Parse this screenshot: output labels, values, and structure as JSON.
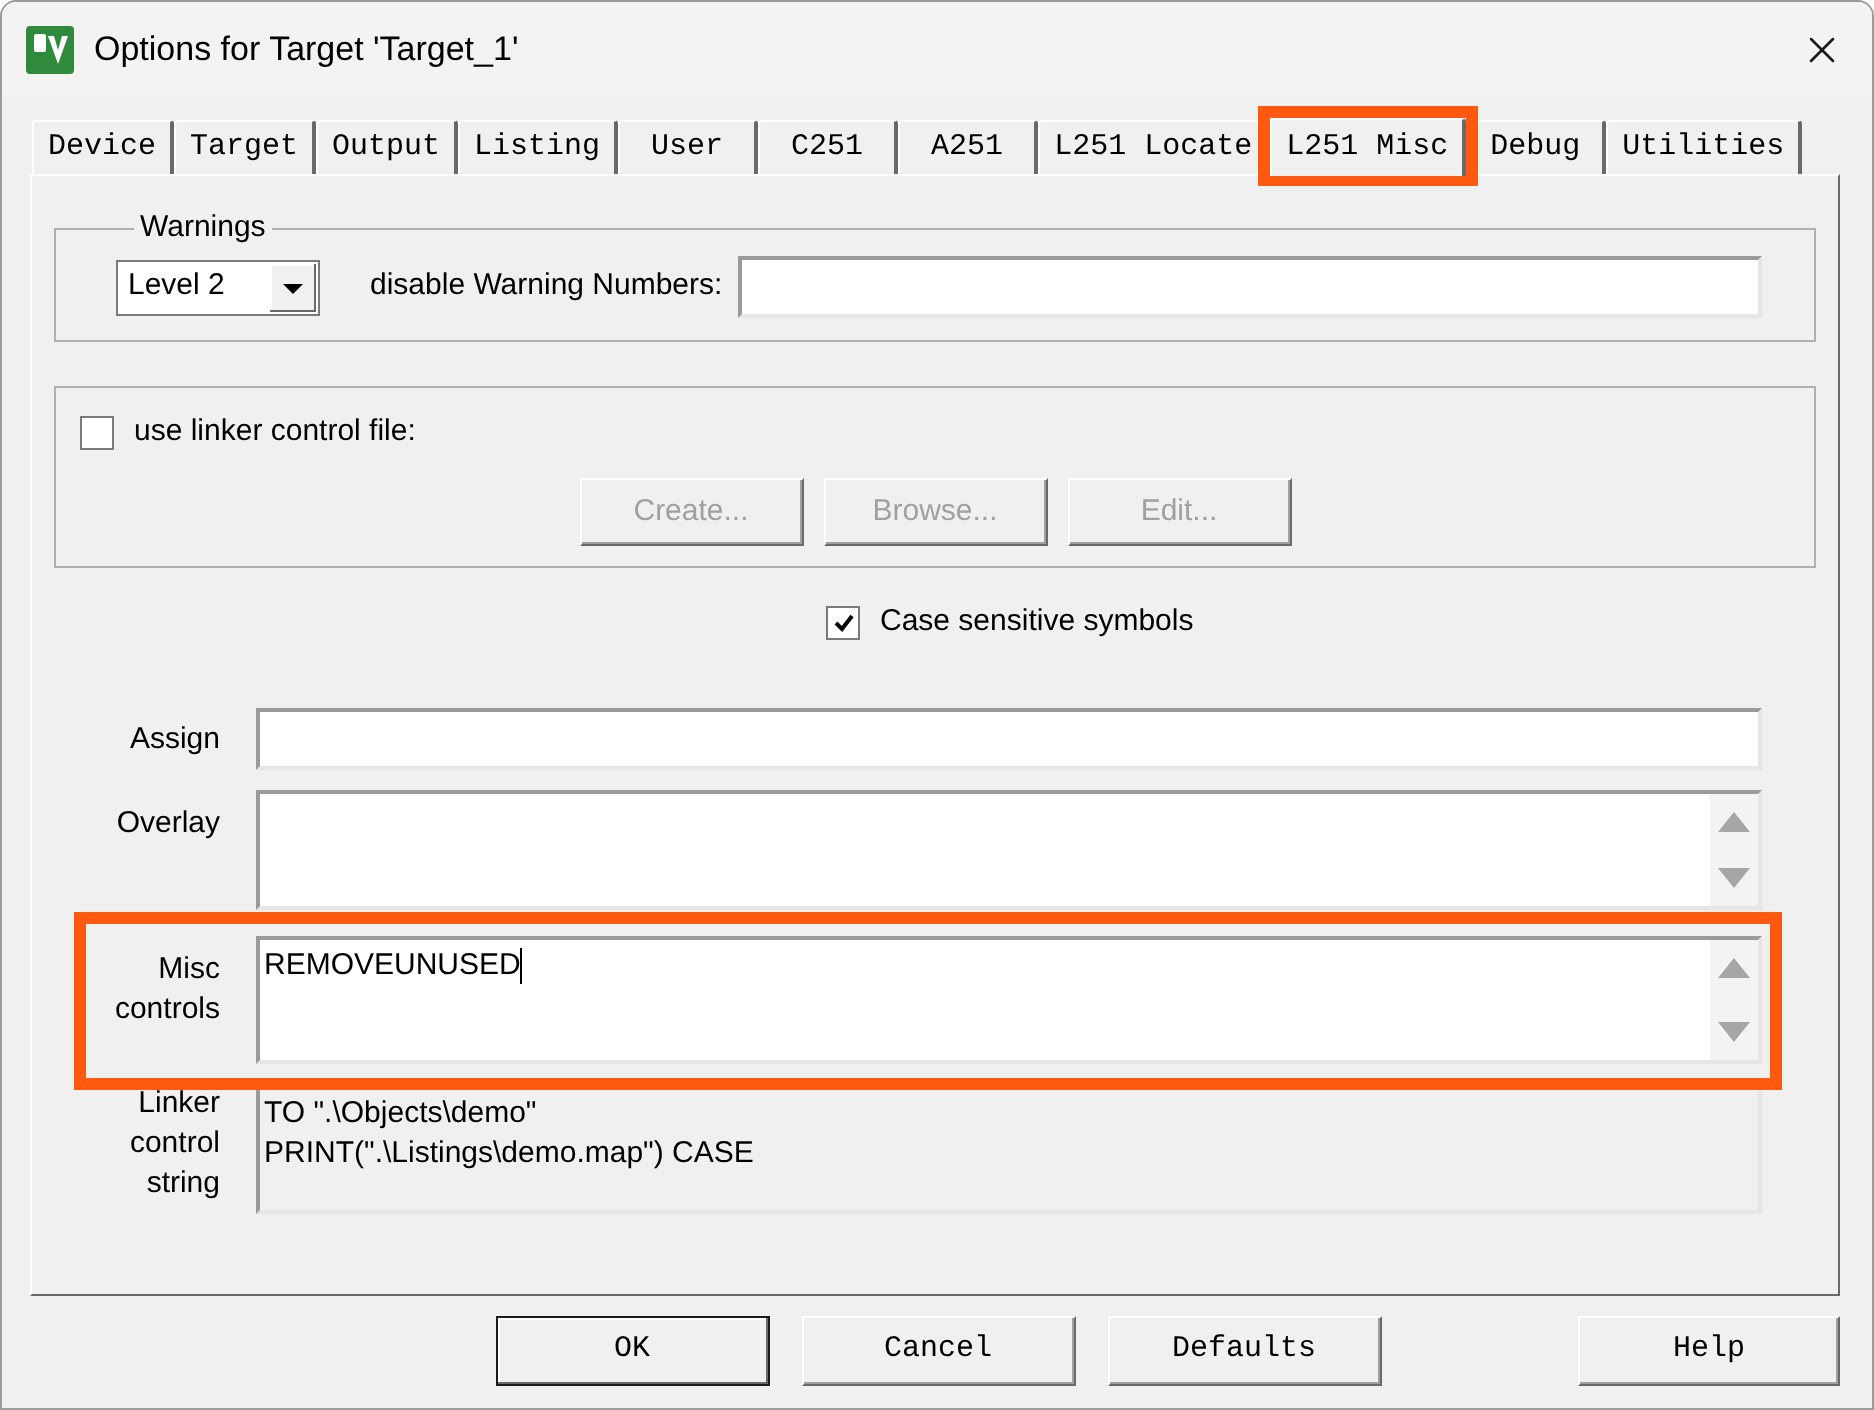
{
  "window": {
    "title": "Options for Target 'Target_1'"
  },
  "tabs": [
    {
      "label": "Device",
      "selected": false,
      "highlighted": false
    },
    {
      "label": "Target",
      "selected": false,
      "highlighted": false
    },
    {
      "label": "Output",
      "selected": false,
      "highlighted": false
    },
    {
      "label": "Listing",
      "selected": false,
      "highlighted": false
    },
    {
      "label": "User",
      "selected": false,
      "highlighted": false
    },
    {
      "label": "C251",
      "selected": false,
      "highlighted": false
    },
    {
      "label": "A251",
      "selected": false,
      "highlighted": false
    },
    {
      "label": "L251 Locate",
      "selected": false,
      "highlighted": false
    },
    {
      "label": "L251 Misc",
      "selected": true,
      "highlighted": true
    },
    {
      "label": "Debug",
      "selected": false,
      "highlighted": false
    },
    {
      "label": "Utilities",
      "selected": false,
      "highlighted": false
    }
  ],
  "warnings": {
    "title": "Warnings",
    "level": "Level 2",
    "disable_label": "disable Warning Numbers:"
  },
  "linker_control_file": {
    "label": "use linker control file:",
    "checked": false,
    "buttons": [
      {
        "label": "Create...",
        "disabled": true
      },
      {
        "label": "Browse...",
        "disabled": true
      },
      {
        "label": "Edit...",
        "disabled": true
      }
    ]
  },
  "case_sensitive": {
    "label": "Case sensitive symbols",
    "checked": true
  },
  "fields": [
    {
      "kind": "single",
      "label": "Assign",
      "focused": false,
      "highlighted": false
    },
    {
      "kind": "multi",
      "label": "Overlay",
      "focused": false,
      "highlighted": false
    },
    {
      "kind": "multi",
      "label": "Misc controls",
      "value": "REMOVEUNUSED",
      "focused": true,
      "highlighted": true
    },
    {
      "kind": "readonly",
      "label": "Linker control string",
      "lines": [
        "TO \".\\Objects\\demo\"",
        "PRINT(\".\\Listings\\demo.map\") CASE"
      ],
      "focused": false,
      "highlighted": false
    }
  ],
  "buttons": [
    {
      "label": "OK",
      "default": true
    },
    {
      "label": "Cancel",
      "default": false
    },
    {
      "label": "Defaults",
      "default": false
    },
    {
      "label": "Help",
      "default": false
    }
  ]
}
